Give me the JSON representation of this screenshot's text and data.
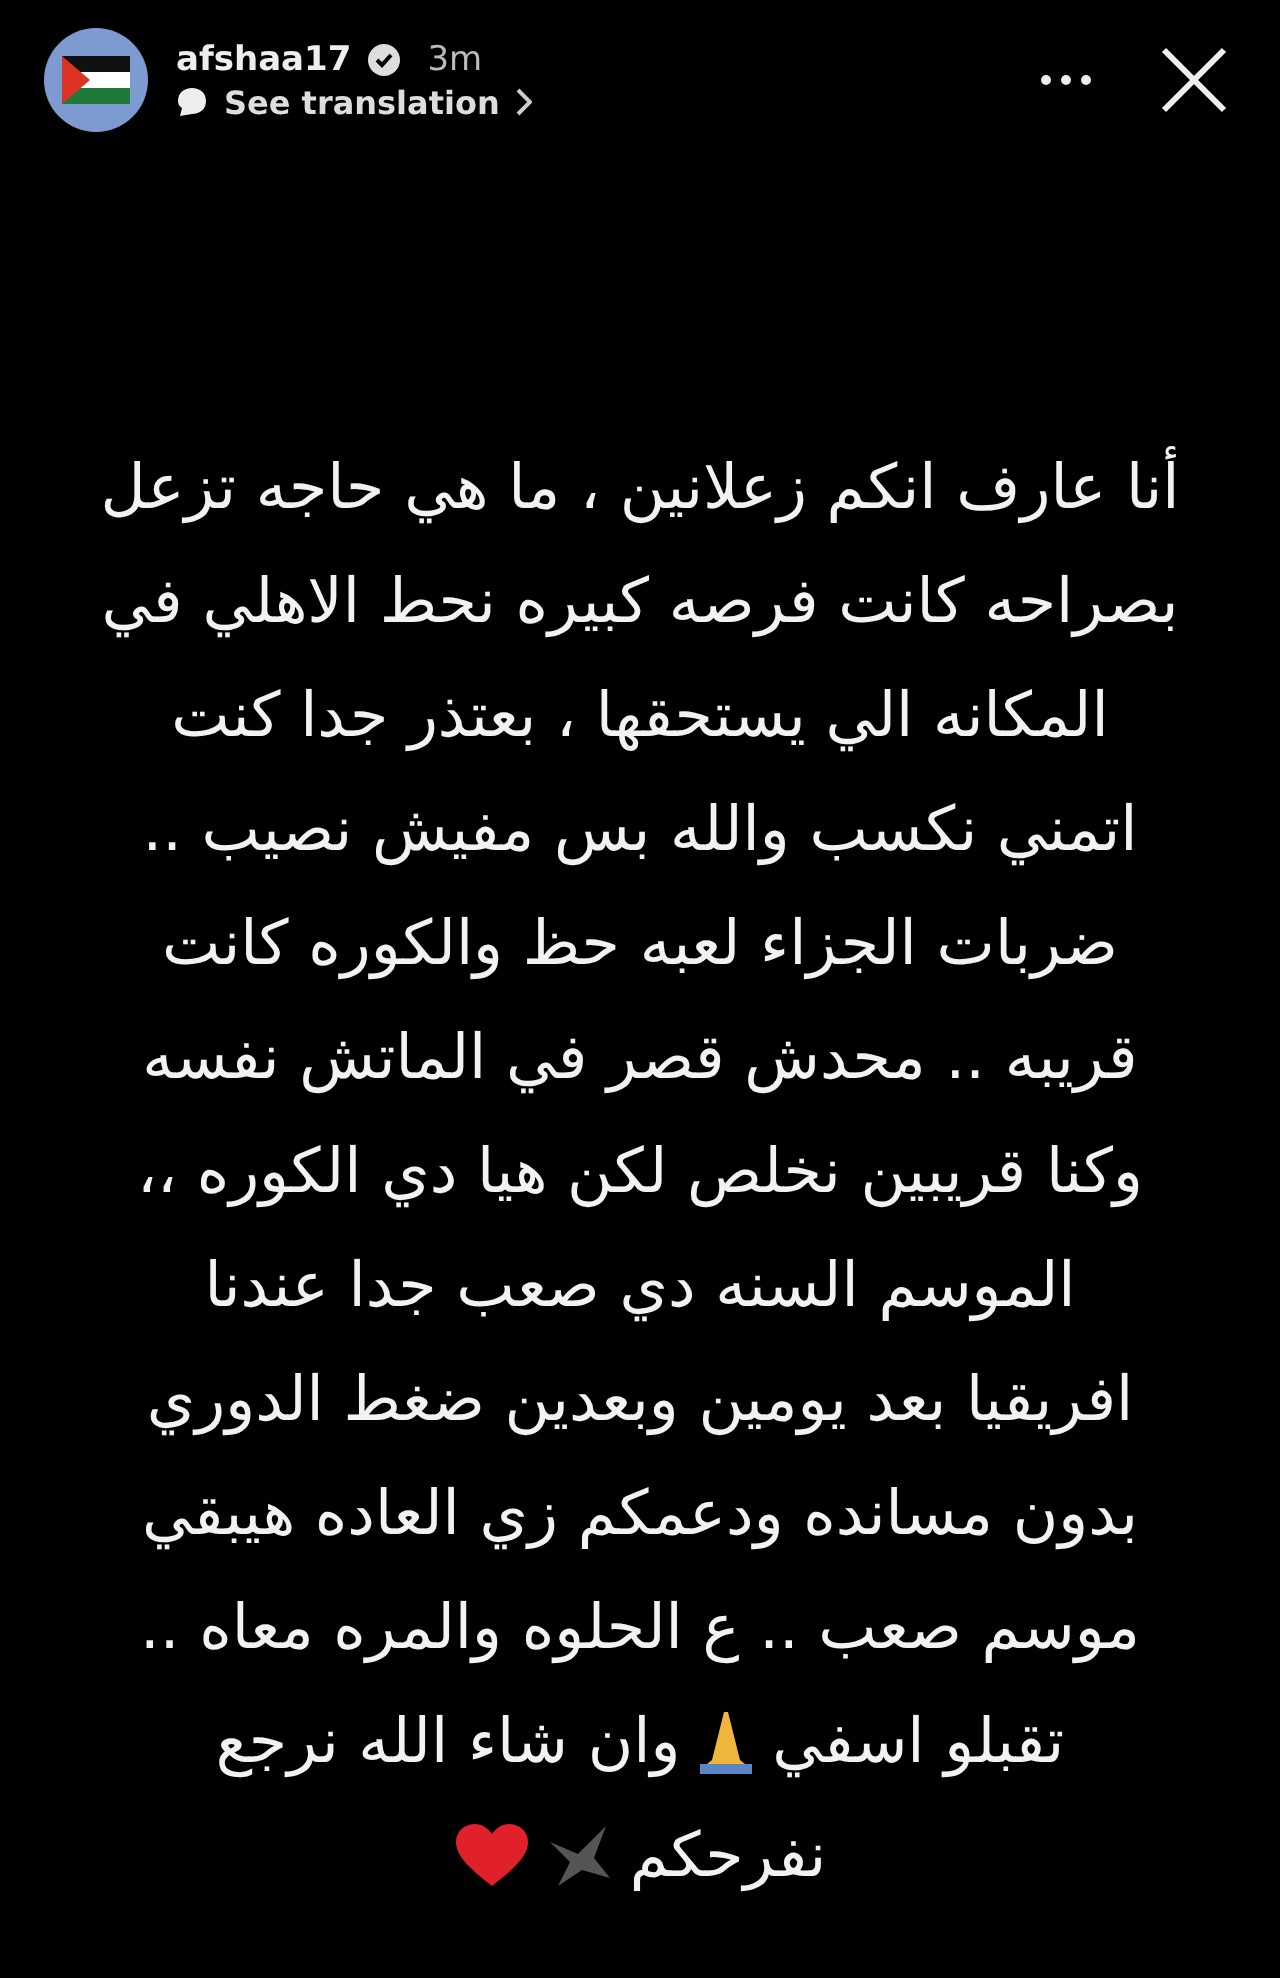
{
  "header": {
    "username": "afshaa17",
    "verified": true,
    "time": "3m",
    "translation_link": "See translation"
  },
  "story": {
    "lines": [
      {
        "segments": [
          {
            "kind": "text",
            "text": "أنا عارف انكم زعلانين ، ما هي حاجه تزعل"
          }
        ]
      },
      {
        "segments": [
          {
            "kind": "text",
            "text": "بصراحه كانت فرصه كبيره نحط الاهلي في"
          }
        ]
      },
      {
        "segments": [
          {
            "kind": "text",
            "text": "المكانه الي يستحقها ، بعتذر جدا كنت"
          }
        ]
      },
      {
        "segments": [
          {
            "kind": "text",
            "text": "اتمني نكسب والله بس مفيش نصيب .."
          }
        ]
      },
      {
        "segments": [
          {
            "kind": "text",
            "text": "ضربات الجزاء لعبه حظ والكوره كانت"
          }
        ]
      },
      {
        "segments": [
          {
            "kind": "text",
            "text": "قريبه .. محدش قصر في الماتش نفسه"
          }
        ]
      },
      {
        "segments": [
          {
            "kind": "text",
            "text": "وكنا قريبين نخلص لكن هيا دي الكوره ،،"
          }
        ]
      },
      {
        "segments": [
          {
            "kind": "text",
            "text": "الموسم السنه دي صعب جدا عندنا"
          }
        ]
      },
      {
        "segments": [
          {
            "kind": "text",
            "text": "افريقيا بعد يومين وبعدين ضغط الدوري"
          }
        ]
      },
      {
        "segments": [
          {
            "kind": "text",
            "text": "بدون مسانده ودعمكم زي العاده هيبقي"
          }
        ]
      },
      {
        "segments": [
          {
            "kind": "text",
            "text": "موسم صعب .. ع الحلوه والمره معاه .."
          }
        ]
      },
      {
        "segments": [
          {
            "kind": "text",
            "text": "تقبلو اسفي"
          },
          {
            "kind": "pray"
          },
          {
            "kind": "text",
            "text": "وان شاء الله نرجع"
          }
        ]
      },
      {
        "segments": [
          {
            "kind": "text",
            "text": "نفرحكم"
          },
          {
            "kind": "eagle"
          },
          {
            "kind": "heart"
          }
        ]
      }
    ]
  }
}
